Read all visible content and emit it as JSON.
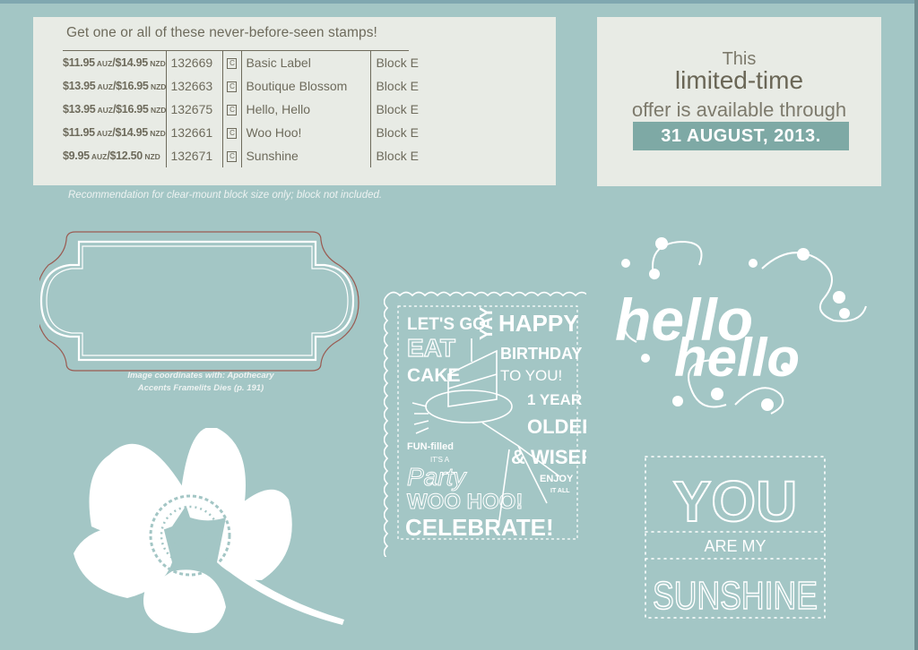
{
  "table_panel": {
    "title": "Get one or all of these never-before-seen stamps!",
    "rows": [
      {
        "price_aud": "$11.95",
        "cur_aud": "AUZ",
        "price_nzd": "$14.95",
        "cur_nzd": "NZD",
        "item_number": "132669",
        "type_icon": "C",
        "name": "Basic Label",
        "block": "Block E"
      },
      {
        "price_aud": "$13.95",
        "cur_aud": "AUZ",
        "price_nzd": "$16.95",
        "cur_nzd": "NZD",
        "item_number": "132663",
        "type_icon": "C",
        "name": "Boutique Blossom",
        "block": "Block E"
      },
      {
        "price_aud": "$13.95",
        "cur_aud": "AUZ",
        "price_nzd": "$16.95",
        "cur_nzd": "NZD",
        "item_number": "132675",
        "type_icon": "C",
        "name": "Hello, Hello",
        "block": "Block E"
      },
      {
        "price_aud": "$11.95",
        "cur_aud": "AUZ",
        "price_nzd": "$14.95",
        "cur_nzd": "NZD",
        "item_number": "132661",
        "type_icon": "C",
        "name": "Woo Hoo!",
        "block": "Block E"
      },
      {
        "price_aud": "$9.95",
        "cur_aud": "AUZ",
        "price_nzd": "$12.50",
        "cur_nzd": "NZD",
        "item_number": "132671",
        "type_icon": "C",
        "name": "Sunshine",
        "block": "Block E"
      }
    ]
  },
  "recommendation_note": "Recommendation for clear-mount block size only; block not included.",
  "offer_panel": {
    "line1": "This",
    "line2": "limited-time",
    "line3": "offer is available through",
    "date": "31 AUGUST, 2013."
  },
  "label_frame": {
    "note_line1": "Image coordinates with: Apothecary",
    "note_line2": "Accents Framelits Dies (p. 191)"
  },
  "woo_hoo_stamp": {
    "lines": [
      "LET'S GO",
      "EAT",
      "CAKE",
      "YAY",
      "HAPPY",
      "BIRTHDAY",
      "TO YOU!",
      "1 YEAR",
      "OLDER",
      "& WISER",
      "FUN-filled",
      "IT'S A",
      "Party",
      "WOO HOO!",
      "ENJOY",
      "IT ALL",
      "CELEBRATE!"
    ]
  },
  "hello_stamp": {
    "word1": "hello",
    "word2": "hello"
  },
  "sunshine_stamp": {
    "word1": "YOU",
    "word2": "ARE MY",
    "word3": "SUNSHINE"
  },
  "colors": {
    "background": "#a3c6c5",
    "panel": "#e8ebe5",
    "text": "#6e6b5c",
    "date_band": "#7ea9a5",
    "stamp_art": "#ffffff",
    "frame_outline": "#9a5b52"
  }
}
